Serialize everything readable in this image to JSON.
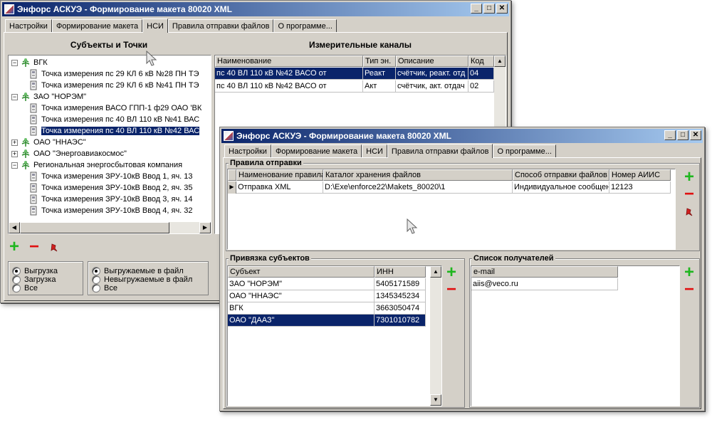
{
  "back_window": {
    "title": "Энфорс АСКУЭ - Формирование макета 80020 XML",
    "tabs": [
      "Настройки",
      "Формирование макета",
      "НСИ",
      "Правила отправки файлов",
      "О программе..."
    ],
    "active_tab": "НСИ",
    "subjects_panel_title": "Субъекты и Точки",
    "channels_panel_title": "Измерительные каналы",
    "tree": [
      {
        "label": "ВГК",
        "level": 0,
        "expander": "minus"
      },
      {
        "label": "Точка измерения  пс 29 КЛ 6 кВ №28 ПН ТЭ",
        "level": 1
      },
      {
        "label": "Точка измерения  пс 29 КЛ 6 кВ №41 ПН ТЭ",
        "level": 1
      },
      {
        "label": "ЗАО \"НОРЭМ\"",
        "level": 0,
        "expander": "minus"
      },
      {
        "label": "Точка измерения  ВАСО ГПП-1 ф29 ОАО 'ВК",
        "level": 1
      },
      {
        "label": "Точка измерения  пс 40 ВЛ 110 кВ №41 ВАС",
        "level": 1
      },
      {
        "label": "Точка измерения  пс 40 ВЛ 110 кВ №42 ВАС",
        "level": 1,
        "selected": true
      },
      {
        "label": "ОАО \"ННАЭС\"",
        "level": 0,
        "expander": "plus"
      },
      {
        "label": "ОАО \"Энергоавиакосмос\"",
        "level": 0,
        "expander": "plus"
      },
      {
        "label": "Региональная энергосбытовая компания",
        "level": 0,
        "expander": "minus"
      },
      {
        "label": "Точка измерения  ЗРУ-10кВ Ввод 1, яч. 13",
        "level": 1
      },
      {
        "label": "Точка измерения  ЗРУ-10кВ Ввод 2, яч. 35",
        "level": 1
      },
      {
        "label": "Точка измерения  ЗРУ-10кВ Ввод 3, яч. 14",
        "level": 1
      },
      {
        "label": "Точка измерения  ЗРУ-10кВ Ввод 4, яч. 32",
        "level": 1
      }
    ],
    "channels_columns": [
      "Наименование",
      "Тип эн.",
      "Описание",
      "Код"
    ],
    "channels_rows": [
      {
        "cells": [
          "пс 40 ВЛ 110 кВ №42 ВАСО от",
          "Реакт",
          "счётчик, реакт. отд",
          "04"
        ],
        "selected": true
      },
      {
        "cells": [
          "пс 40 ВЛ 110 кВ №42 ВАСО от",
          "Акт",
          "счётчик, акт. отдач",
          "02"
        ],
        "selected": false
      }
    ],
    "radio_group_1": [
      {
        "label": "Выгрузка",
        "checked": true
      },
      {
        "label": "Загрузка",
        "checked": false
      },
      {
        "label": "Все",
        "checked": false
      }
    ],
    "radio_group_2": [
      {
        "label": "Выгружаемые в файл",
        "checked": true
      },
      {
        "label": "Невыгружаемые в файл",
        "checked": false
      },
      {
        "label": "Все",
        "checked": false
      }
    ]
  },
  "front_window": {
    "title": "Энфорс АСКУЭ - Формирование макета 80020 XML",
    "tabs": [
      "Настройки",
      "Формирование макета",
      "НСИ",
      "Правила отправки файлов",
      "О программе..."
    ],
    "active_tab": "Правила отправки файлов",
    "rules_group_title": "Правила отправки",
    "rules_columns": [
      "Наименование правила",
      "Каталог хранения файлов",
      "Способ отправки файлов",
      "Номер АИИС"
    ],
    "rules_rows": [
      {
        "cells": [
          "Отправка XML",
          "D:\\Exe\\enforce22\\Makets_80020\\1",
          "Индивидуальное сообщени",
          "12123"
        ]
      }
    ],
    "binding_group_title": "Привязка субъектов",
    "binding_columns": [
      "Субъект",
      "ИНН"
    ],
    "binding_rows": [
      {
        "cells": [
          "ЗАО \"НОРЭМ\"",
          "5405171589"
        ],
        "selected": false
      },
      {
        "cells": [
          "ОАО \"ННАЭС\"",
          "1345345234"
        ],
        "selected": false
      },
      {
        "cells": [
          "ВГК",
          "3663050474"
        ],
        "selected": false
      },
      {
        "cells": [
          "ОАО \"ДААЗ\"",
          "7301010782"
        ],
        "selected": true
      }
    ],
    "recipients_group_title": "Список получателей",
    "recipients_columns": [
      "e-mail"
    ],
    "recipients_rows": [
      {
        "cells": [
          "aiis@veco.ru"
        ]
      }
    ]
  },
  "colors": {
    "window_bg": "#d4d0c8",
    "title_start": "#0a246a",
    "title_end": "#a6caf0",
    "selection": "#0a246a",
    "add_green": "#1fb61f",
    "remove_red": "#e01010"
  },
  "icons": {
    "title_controls": [
      "minimize-icon",
      "maximize-icon",
      "close-icon"
    ],
    "tree_folder": "subject-tree-icon",
    "tree_leaf": "measurement-point-icon",
    "actions": [
      "add-icon",
      "remove-icon",
      "pin-icon"
    ]
  }
}
